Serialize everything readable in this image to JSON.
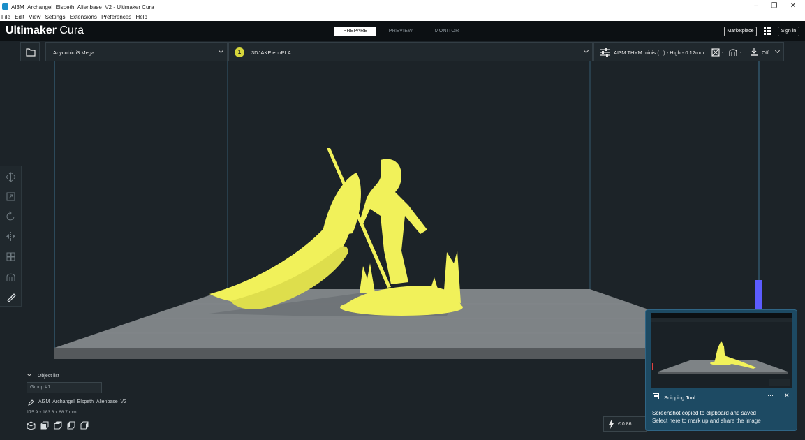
{
  "window": {
    "title": "AI3M_Archangel_Elspeth_Alienbase_V2 - Ultimaker Cura",
    "menu": [
      "File",
      "Edit",
      "View",
      "Settings",
      "Extensions",
      "Preferences",
      "Help"
    ]
  },
  "header": {
    "brand_bold": "Ultimaker",
    "brand_light": " Cura",
    "tabs": [
      {
        "label": "PREPARE",
        "active": true
      },
      {
        "label": "PREVIEW",
        "active": false
      },
      {
        "label": "MONITOR",
        "active": false
      }
    ],
    "marketplace": "Marketplace",
    "signin": "Sign in"
  },
  "toolbar": {
    "printer": "Anycubic i3 Mega",
    "material_index": "1",
    "material": "3DJAKE ecoPLA",
    "profile": "AI3M THYM minis (...) - High - 0.12mm",
    "adhesion": "Off"
  },
  "tools": [
    "move-icon",
    "scale-icon",
    "rotate-icon",
    "mirror-icon",
    "per-model-settings-icon",
    "support-blocker-icon",
    "measure-icon"
  ],
  "object_list": {
    "toggle": "Object list",
    "group": "Group #1",
    "name": "AI3M_Archangel_Elspeth_Alienbase_V2",
    "dimensions": "175.9 x 183.6 x 68.7 mm"
  },
  "cost": "€ 0.86",
  "toast": {
    "app": "Snipping Tool",
    "line1": "Screenshot copied to clipboard and saved",
    "line2": "Select here to mark up and share the image"
  },
  "colors": {
    "model": "#f1f15a",
    "accent": "#1a8ec9",
    "height_bar": "#5c5cff"
  }
}
